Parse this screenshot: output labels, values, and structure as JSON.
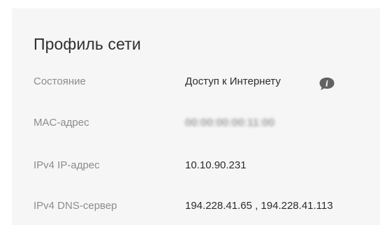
{
  "profile": {
    "title": "Профиль сети",
    "rows": [
      {
        "label": "Состояние",
        "value": "Доступ к Интернету"
      },
      {
        "label": "MAC-адрес",
        "value": "00:00:00:00:11:00"
      },
      {
        "label": "IPv4 IP-адрес",
        "value": "10.10.90.231"
      },
      {
        "label": "IPv4 DNS-сервер",
        "value": "194.228.41.65 , 194.228.41.113"
      }
    ],
    "status_info_icon": "info-icon"
  }
}
